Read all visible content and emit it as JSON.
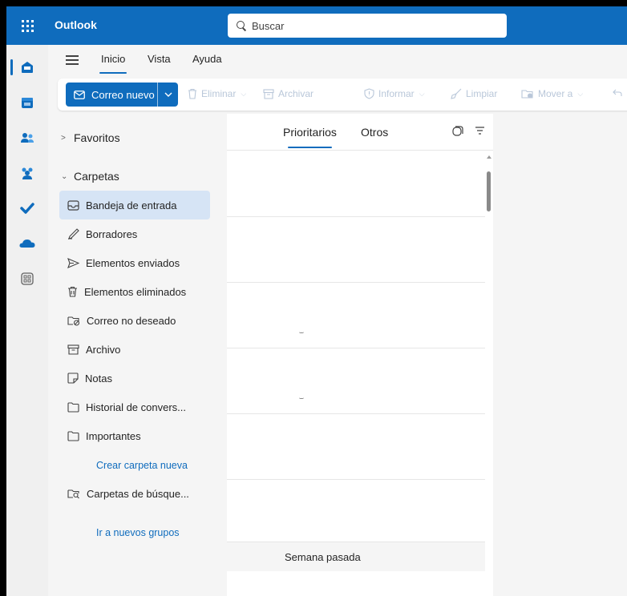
{
  "app": {
    "title": "Outlook"
  },
  "search": {
    "placeholder": "Buscar"
  },
  "ribbon": {
    "tabs": [
      {
        "label": "Inicio",
        "selected": true
      },
      {
        "label": "Vista",
        "selected": false
      },
      {
        "label": "Ayuda",
        "selected": false
      }
    ],
    "new_mail_label": "Correo nuevo",
    "buttons": {
      "delete": "Eliminar",
      "archive": "Archivar",
      "report": "Informar",
      "sweep": "Limpiar",
      "move": "Mover a"
    }
  },
  "rail": {
    "items": [
      {
        "icon": "mail-icon",
        "active": true
      },
      {
        "icon": "calendar-icon"
      },
      {
        "icon": "people-icon"
      },
      {
        "icon": "groups-icon"
      },
      {
        "icon": "todo-icon"
      },
      {
        "icon": "onedrive-icon"
      },
      {
        "icon": "more-apps-icon"
      }
    ]
  },
  "folders": {
    "favorites_label": "Favoritos",
    "folders_label": "Carpetas",
    "items": [
      {
        "label": "Bandeja de entrada",
        "icon": "inbox-icon",
        "active": true
      },
      {
        "label": "Borradores",
        "icon": "drafts-icon"
      },
      {
        "label": "Elementos enviados",
        "icon": "sent-icon"
      },
      {
        "label": "Elementos eliminados",
        "icon": "trash-icon"
      },
      {
        "label": "Correo no deseado",
        "icon": "junk-icon"
      },
      {
        "label": "Archivo",
        "icon": "archive-icon"
      },
      {
        "label": "Notas",
        "icon": "notes-icon"
      },
      {
        "label": "Historial de convers...",
        "icon": "folder-icon"
      },
      {
        "label": "Importantes",
        "icon": "folder-icon"
      }
    ],
    "create_folder_link": "Crear carpeta nueva",
    "search_folders_label": "Carpetas de búsque...",
    "new_groups_link": "Ir a nuevos grupos"
  },
  "message_list": {
    "tabs": [
      {
        "label": "Prioritarios",
        "selected": true
      },
      {
        "label": "Otros",
        "selected": false
      }
    ],
    "section_label": "Semana pasada"
  },
  "colors": {
    "accent": "#0f6cbd",
    "selected_folder": "#d6e4f5"
  }
}
